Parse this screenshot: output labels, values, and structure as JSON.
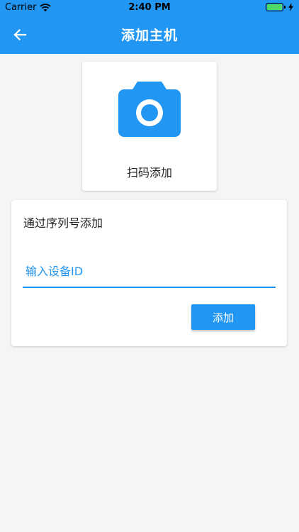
{
  "status_bar": {
    "carrier": "Carrier",
    "time": "2:40 PM",
    "battery_level_percent": 100
  },
  "app_bar": {
    "title": "添加主机",
    "back_icon": "arrow-back-icon"
  },
  "scan_card": {
    "icon": "camera-icon",
    "label": "扫码添加"
  },
  "serial_card": {
    "title": "通过序列号添加",
    "input": {
      "placeholder": "输入设备ID",
      "value": ""
    },
    "add_label": "添加"
  },
  "colors": {
    "primary": "#2196f3",
    "background": "#f5f5f5",
    "card": "#ffffff"
  }
}
